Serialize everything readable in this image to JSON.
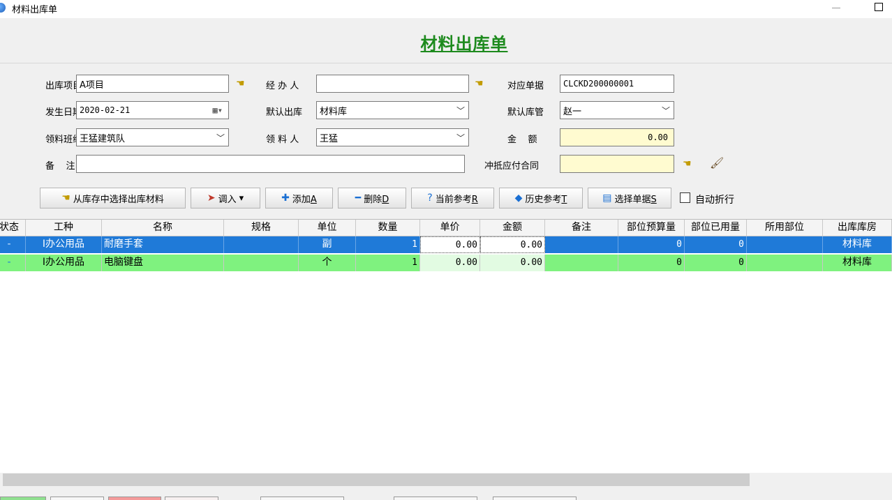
{
  "window": {
    "title": "材料出库单"
  },
  "form": {
    "title": "材料出库单",
    "project_label": "出库项目",
    "project_value": "A项目",
    "handler_label": "经 办 人",
    "handler_value": "",
    "ref_doc_label": "对应单据",
    "ref_doc_value": "CLCKD200000001",
    "date_label": "发生日期",
    "date_value": "2020-02-21",
    "default_out_label": "默认出库",
    "default_out_value": "材料库",
    "default_keeper_label": "默认库管",
    "default_keeper_value": "赵一",
    "team_label": "领料班组",
    "team_value": "王猛建筑队",
    "receiver_label": "领 料 人",
    "receiver_value": "王猛",
    "amount_label": "金    额",
    "amount_value": "0.00",
    "remark_label": "备    注",
    "remark_value": "",
    "offset_contract_label": "冲抵应付合同",
    "offset_contract_value": ""
  },
  "toolbar": {
    "select_from_stock": "从库存中选择出库材料",
    "import": "调入",
    "add": "添加",
    "add_key": "A",
    "delete": "删除",
    "delete_key": "D",
    "current_ref": "当前参考",
    "current_ref_key": "R",
    "history_ref": "历史参考",
    "history_ref_key": "T",
    "select_doc": "选择单据",
    "select_doc_key": "S",
    "auto_wrap": "自动折行"
  },
  "grid": {
    "columns": [
      "状态",
      "工种",
      "名称",
      "规格",
      "单位",
      "数量",
      "单价",
      "金额",
      "备注",
      "部位预算量",
      "部位已用量",
      "所用部位",
      "出库库房"
    ],
    "rows": [
      {
        "status": "-",
        "trade": "I办公用品",
        "name": "耐磨手套",
        "spec": "",
        "unit": "副",
        "qty": "1",
        "price": "0.00",
        "amount": "0.00",
        "note": "",
        "budget": "0",
        "used": "0",
        "part": "",
        "warehouse": "材料库"
      },
      {
        "status": "-",
        "trade": "I办公用品",
        "name": "电脑键盘",
        "spec": "",
        "unit": "个",
        "qty": "1",
        "price": "0.00",
        "amount": "0.00",
        "note": "",
        "budget": "0",
        "used": "0",
        "part": "",
        "warehouse": "材料库"
      }
    ]
  },
  "colors": {
    "title_green": "#1d8a1d",
    "selected_row": "#1f7ad8",
    "green_row": "#7ff27f",
    "yellow_field": "#fffbd0"
  },
  "icons": [
    "app-icon",
    "finger-point-icon",
    "calendar-icon",
    "brush-icon",
    "import-icon",
    "plus-icon",
    "minus-icon",
    "help-cursor-icon",
    "history-icon",
    "select-doc-icon"
  ]
}
